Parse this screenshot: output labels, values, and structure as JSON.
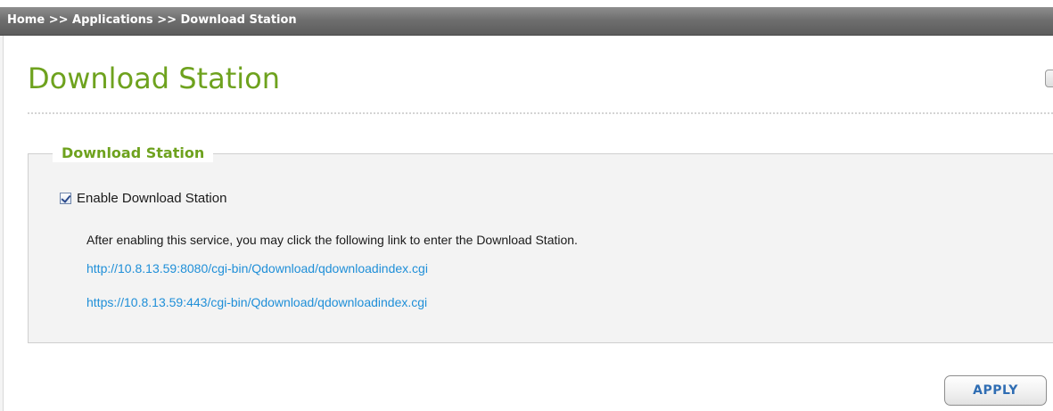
{
  "breadcrumb": {
    "text": "Home >> Applications >> Download Station"
  },
  "page": {
    "title": "Download Station"
  },
  "group": {
    "legend": "Download Station",
    "enable_label": "Enable Download Station",
    "enable_checked": true,
    "help_text": "After enabling this service, you may click the following link to enter the Download Station.",
    "links": [
      "http://10.8.13.59:8080/cgi-bin/Qdownload/qdownloadindex.cgi",
      "https://10.8.13.59:443/cgi-bin/Qdownload/qdownloadindex.cgi"
    ]
  },
  "actions": {
    "apply_label": "APPLY"
  },
  "icons": {
    "checkbox": "checkbox-checked-icon",
    "corner": "help-button-icon"
  },
  "colors": {
    "title_green": "#6ea21e",
    "link_blue": "#1f8fd8",
    "apply_text": "#2f6db3",
    "breadcrumb_bar": "#6f6f6f"
  }
}
